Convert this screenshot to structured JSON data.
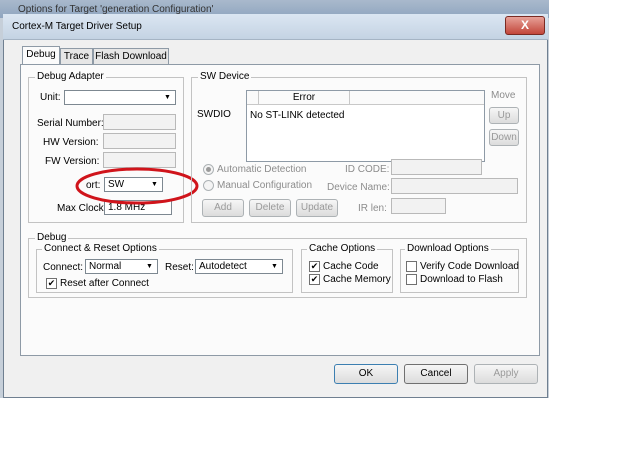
{
  "background_window": {
    "title": "Options for Target 'generation Configuration'"
  },
  "dialog": {
    "title": "Cortex-M Target Driver Setup",
    "close": "X"
  },
  "tabs": [
    {
      "label": "Debug"
    },
    {
      "label": "Trace"
    },
    {
      "label": "Flash Download"
    }
  ],
  "debug_adapter": {
    "legend": "Debug Adapter",
    "unit_label": "Unit:",
    "unit_value": "",
    "serial_label": "Serial Number:",
    "hw_label": "HW Version:",
    "fw_label": "FW Version:",
    "port_label": "ort:",
    "port_value": "SW",
    "clock_label": "Max Clock:",
    "clock_value": "1.8 MHz"
  },
  "sw_device": {
    "legend": "SW Device",
    "swdio": "SWDIO",
    "col_blank": "",
    "col_error": "Error",
    "row_text": "No ST-LINK detected",
    "move_label": "Move",
    "up_button": "Up",
    "down_button": "Down",
    "auto_detect": "Automatic Detection",
    "manual_config": "Manual Configuration",
    "idcode_label": "ID CODE:",
    "devname_label": "Device Name:",
    "irlen_label": "IR len:",
    "add_button": "Add",
    "delete_button": "Delete",
    "update_button": "Update"
  },
  "debug": {
    "legend": "Debug",
    "connect_legend": "Connect & Reset Options",
    "connect_label": "Connect:",
    "connect_value": "Normal",
    "reset_label": "Reset:",
    "reset_value": "Autodetect",
    "reset_after_connect": "Reset after Connect",
    "cache_legend": "Cache Options",
    "cache_code": "Cache Code",
    "cache_memory": "Cache Memory",
    "download_legend": "Download Options",
    "verify_download": "Verify Code Download",
    "download_flash": "Download to Flash",
    "check_mark": "✔"
  },
  "footer": {
    "ok": "OK",
    "cancel": "Cancel",
    "apply": "Apply"
  },
  "colors": {
    "annotation_circle": "#d0141b",
    "dialog_bg": "#f0f0f0"
  }
}
